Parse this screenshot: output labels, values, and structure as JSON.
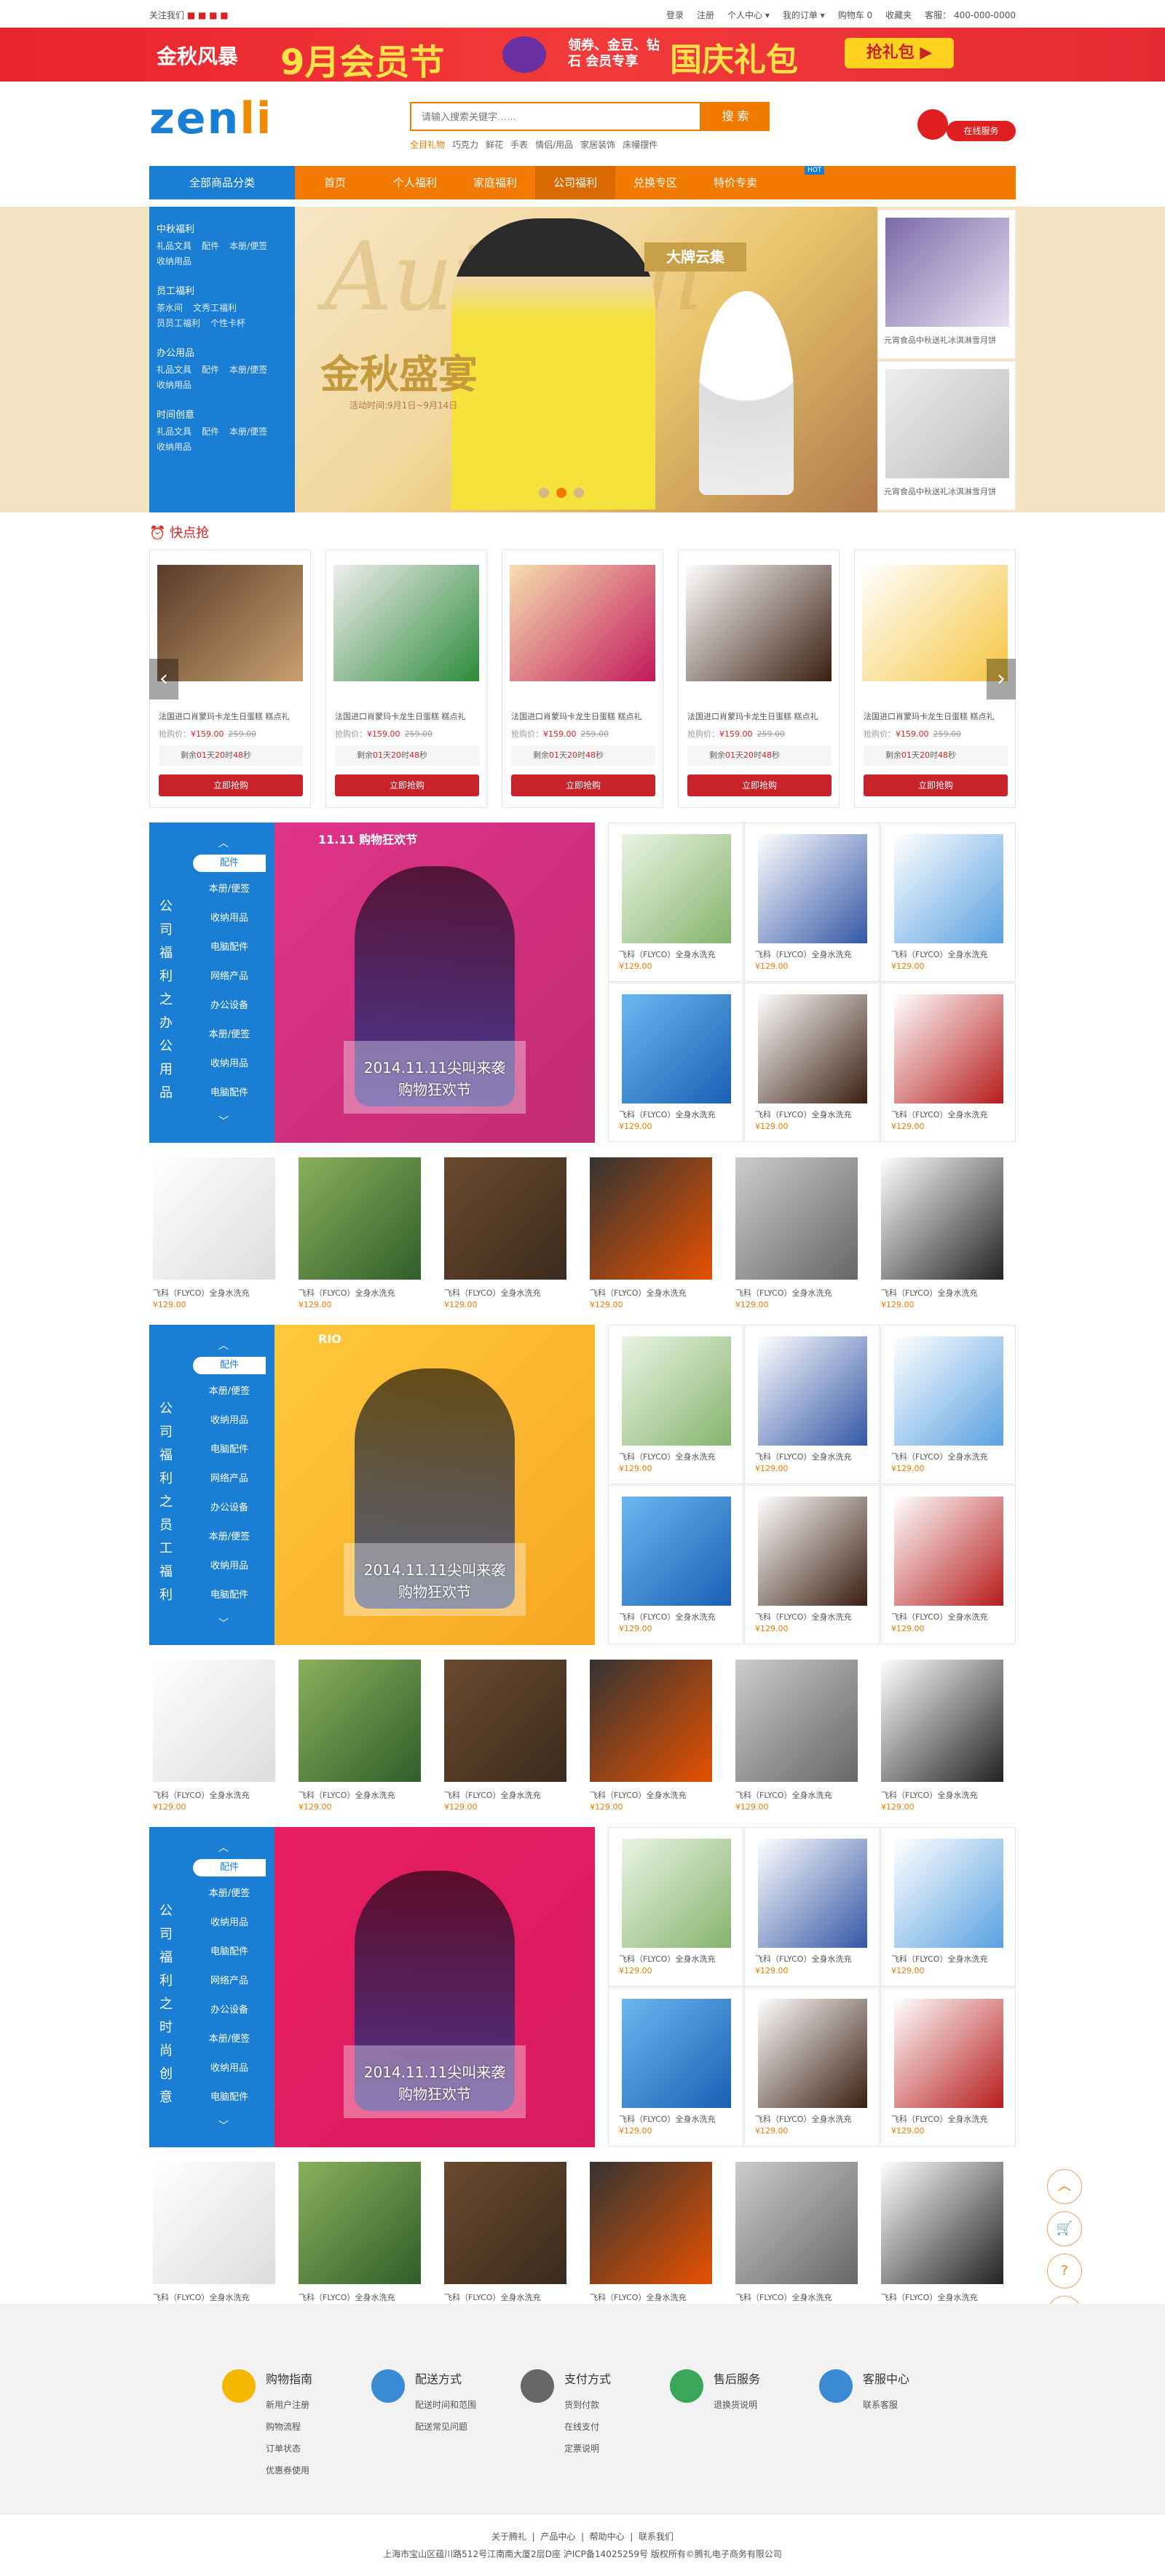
{
  "topbar": {
    "follow": "关注我们",
    "links": [
      "登录",
      "注册",
      "个人中心 ▾",
      "我的订单 ▾",
      "购物车 0",
      "收藏夹",
      "客服： 400-000-0000"
    ]
  },
  "promo_banner": {
    "brand": "金秋风暴",
    "event": "9月会员节",
    "tagline": "领券、金豆、钻石 会员专享",
    "gift": "国庆礼包",
    "cta": "抢礼包 ▶"
  },
  "header": {
    "logo_main": "zen",
    "logo_accent": "li",
    "search_placeholder": "请输入搜索关键字……",
    "search_button": "搜 索",
    "hot_words": [
      "全目礼物",
      "巧克力",
      "鲜花",
      "手表",
      "情侣/用品",
      "家居装饰",
      "床幔摆件"
    ],
    "service": "在线服务"
  },
  "nav": {
    "all_categories": "全部商品分类",
    "items": [
      "首页",
      "个人福利",
      "家庭福利",
      "公司福利",
      "兑换专区",
      "特价专卖"
    ],
    "hot_badge": "HOT"
  },
  "categories": [
    {
      "title": "中秋福利",
      "subs": [
        "礼品文具",
        "配件",
        "本册/便签",
        "收纳用品"
      ]
    },
    {
      "title": "员工福利",
      "subs": [
        "茶水间",
        "文秀工福利",
        "员员工福利",
        "个性卡杯"
      ]
    },
    {
      "title": "办公用品",
      "subs": [
        "礼品文具",
        "配件",
        "本册/便签",
        "收纳用品"
      ]
    },
    {
      "title": "时间创意",
      "subs": [
        "礼品文具",
        "配件",
        "本册/便签",
        "收纳用品"
      ]
    }
  ],
  "hero": {
    "script_word": "Autumn",
    "title": "金秋盛宴",
    "subtitle": "活动时间:9月1日~9月14日",
    "tag": "大牌云集",
    "side_caption": "元宵食品中秋送礼冰淇淋雪月饼"
  },
  "quick": {
    "title": "快点抢",
    "items_desc": "法国进口肖蒙玛卡龙生日蛋糕 糕点礼",
    "price_label": "抢购价：",
    "price": "¥159.00",
    "old_price": "259.00",
    "countdown": [
      "剩余",
      "01",
      "天",
      "20",
      "时",
      "48",
      "秒"
    ],
    "buy": "立即抢购"
  },
  "floors": [
    {
      "title": "公司福利之办公用品",
      "tab": "配件",
      "subs": [
        "本册/便签",
        "收纳用品",
        "电脑配件",
        "网络产品",
        "办公设备",
        "本册/便签",
        "收纳用品",
        "电脑配件"
      ],
      "ad_caption_1": "2014.11.11尖叫来袭",
      "ad_caption_2": "购物狂欢节",
      "ad_badge": "11.11 购物狂欢节"
    },
    {
      "title": "公司福利之员工福利",
      "tab": "配件",
      "subs": [
        "本册/便签",
        "收纳用品",
        "电脑配件",
        "网络产品",
        "办公设备",
        "本册/便签",
        "收纳用品",
        "电脑配件"
      ],
      "ad_caption_1": "2014.11.11尖叫来袭",
      "ad_caption_2": "购物狂欢节",
      "ad_badge": "RIO"
    },
    {
      "title": "公司福利之时尚创意",
      "tab": "配件",
      "subs": [
        "本册/便签",
        "收纳用品",
        "电脑配件",
        "网络产品",
        "办公设备",
        "本册/便签",
        "收纳用品",
        "电脑配件"
      ],
      "ad_caption_1": "2014.11.11尖叫来袭",
      "ad_caption_2": "购物狂欢节",
      "ad_badge": ""
    }
  ],
  "product": {
    "name": "飞科（FLYCO）全身水洗充",
    "price": "¥129.00"
  },
  "footer": {
    "cols": [
      {
        "title": "购物指南",
        "items": [
          "新用户注册",
          "购物流程",
          "订单状态",
          "优惠券使用"
        ]
      },
      {
        "title": "配送方式",
        "items": [
          "配送时间和范围",
          "配送常见问题"
        ]
      },
      {
        "title": "支付方式",
        "items": [
          "货到付款",
          "在线支付",
          "定票说明"
        ]
      },
      {
        "title": "售后服务",
        "items": [
          "退换货说明"
        ]
      },
      {
        "title": "客服中心",
        "items": [
          "联系客服"
        ]
      }
    ],
    "links": [
      "关于腾礼",
      "产品中心",
      "帮助中心",
      "联系我们"
    ],
    "address": "上海市宝山区蕴川路512号江南南大厦2层D座 沪ICP备14025259号 版权所有©腾礼电子商务有限公司"
  },
  "float": [
    "︿",
    "🛒",
    "?",
    "···"
  ]
}
